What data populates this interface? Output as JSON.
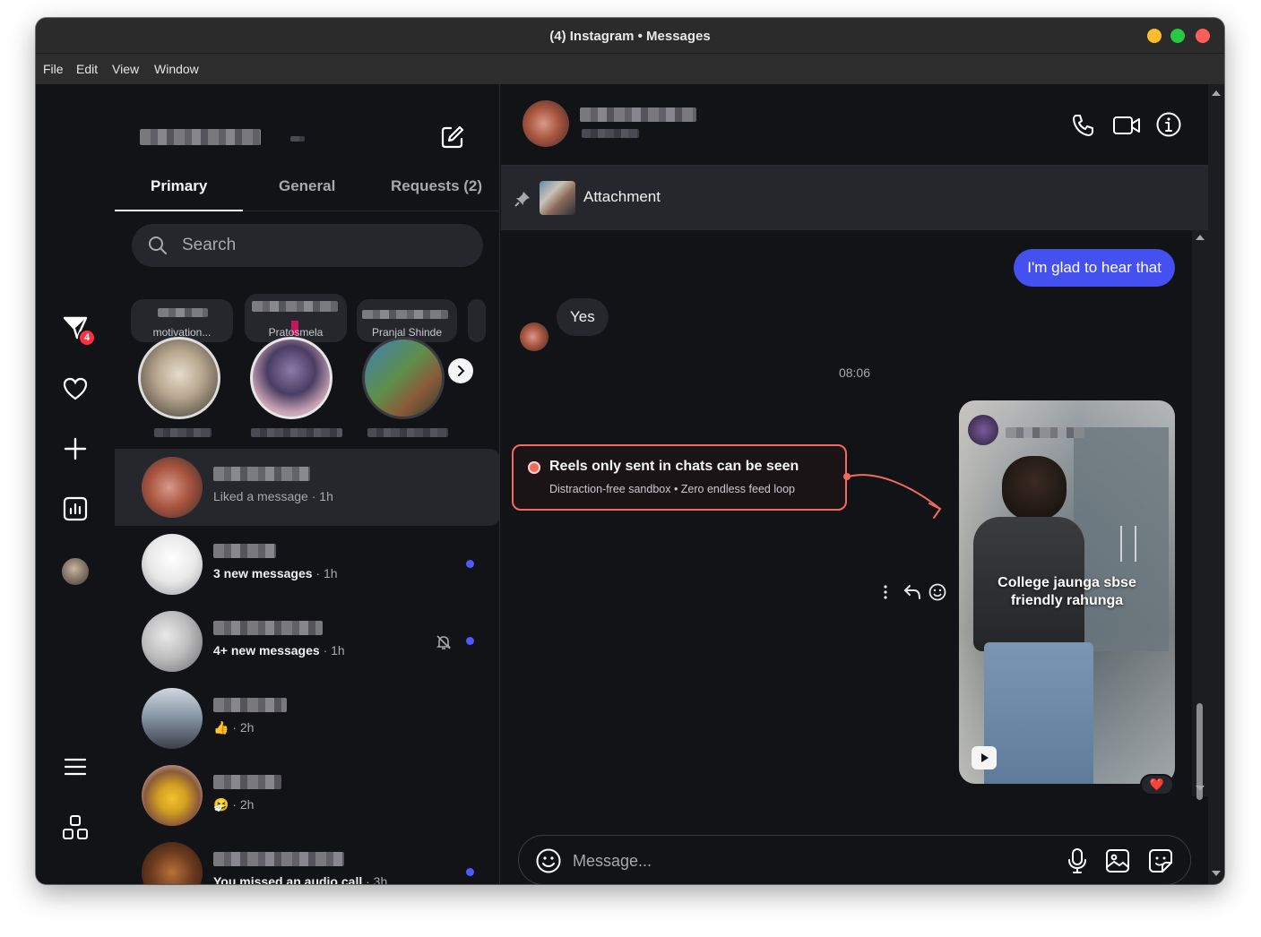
{
  "window": {
    "title": "(4) Instagram • Messages",
    "traffic_colors": [
      "#febc2e",
      "#28c840",
      "#ff5f57"
    ]
  },
  "menu": [
    "File",
    "Edit",
    "View",
    "Window"
  ],
  "rail": {
    "badge_count": "4",
    "accent": "#ff3040",
    "icons": [
      "messenger-icon",
      "heart-icon",
      "plus-icon",
      "insights-icon",
      "profile-avatar",
      "menu-icon",
      "apps-icon"
    ]
  },
  "inbox": {
    "tabs": [
      {
        "label": "Primary",
        "active": true
      },
      {
        "label": "General",
        "active": false
      },
      {
        "label": "Requests (2)",
        "active": false
      }
    ],
    "search_placeholder": "Search",
    "notes": [
      {
        "text": "motivation..."
      },
      {
        "text": "Pratosmela"
      },
      {
        "text": "Pranjal Shinde"
      }
    ],
    "threads": [
      {
        "preview": "Liked a message",
        "time": "· 1h",
        "bold": false,
        "unread": false,
        "muted": false
      },
      {
        "preview": "3 new messages",
        "time": "· 1h",
        "bold": true,
        "unread": true,
        "muted": false
      },
      {
        "preview": "4+ new messages",
        "time": "· 1h",
        "bold": true,
        "unread": true,
        "muted": true
      },
      {
        "preview": "👍",
        "time": "· 2h",
        "bold": false,
        "unread": false,
        "muted": false
      },
      {
        "preview": "🤧",
        "time": "· 2h",
        "bold": false,
        "unread": false,
        "muted": false
      },
      {
        "preview": "You missed an audio call",
        "time": "· 3h",
        "bold": true,
        "unread": true,
        "muted": false
      }
    ]
  },
  "chat": {
    "pinned_label": "Attachment",
    "messages": {
      "outgoing": "I'm glad to hear that",
      "incoming": "Yes"
    },
    "timestamp": "08:06",
    "callout": {
      "title": "Reels only sent in chats can be seen",
      "subtitle": "Distraction-free sandbox • Zero endless feed loop",
      "color": "#f26a5e"
    },
    "reel_caption_line1": "College jaunga sbse",
    "reel_caption_line2": "friendly rahunga",
    "reaction": "❤️",
    "composer_placeholder": "Message...",
    "bubble_color": "#4450f0"
  }
}
